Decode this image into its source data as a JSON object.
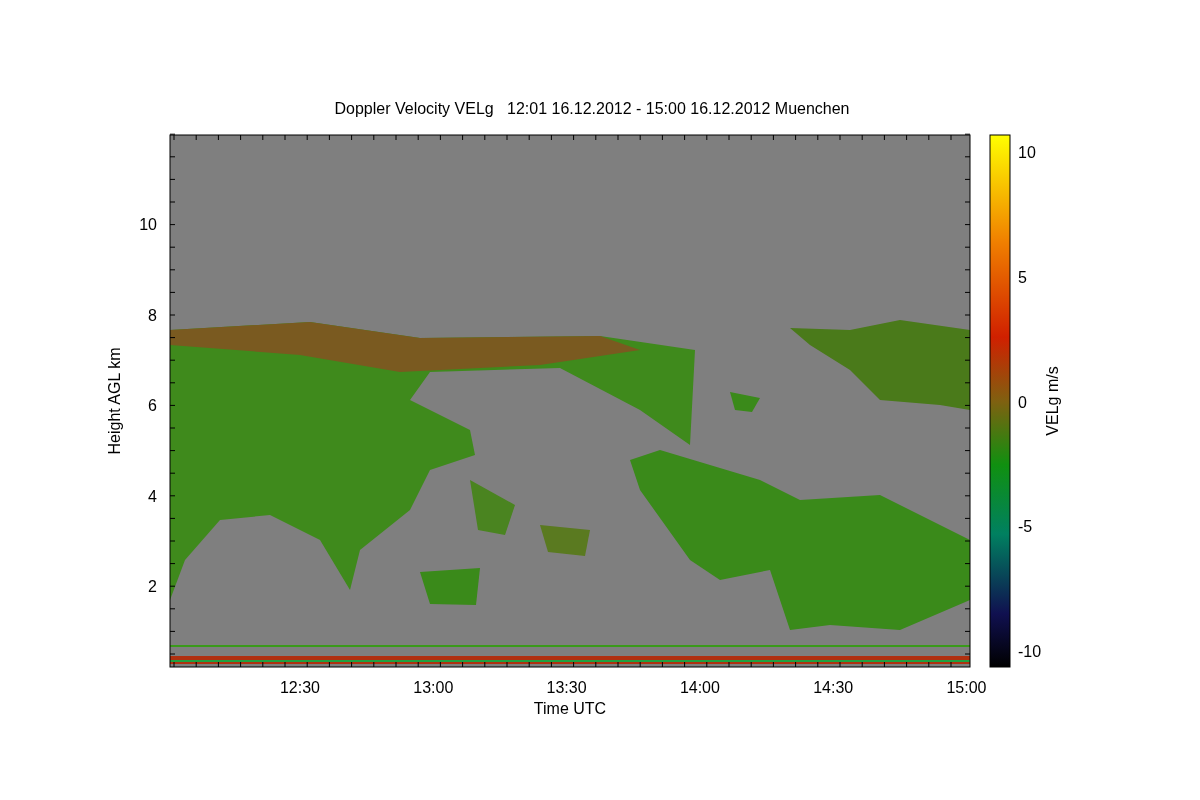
{
  "title": "Doppler Velocity VELg   12:01 16.12.2012 - 15:00 16.12.2012 Muenchen",
  "xlabel": "Time UTC",
  "ylabel": "Height AGL km",
  "xticks": [
    "12:30",
    "13:00",
    "13:30",
    "14:00",
    "14:30",
    "15:00"
  ],
  "yticks": [
    "10",
    "8",
    "6",
    "4",
    "2"
  ],
  "colorbar": {
    "label": "VELg m/s",
    "ticks": [
      "10",
      "5",
      "0",
      "-5",
      "-10"
    ]
  }
}
